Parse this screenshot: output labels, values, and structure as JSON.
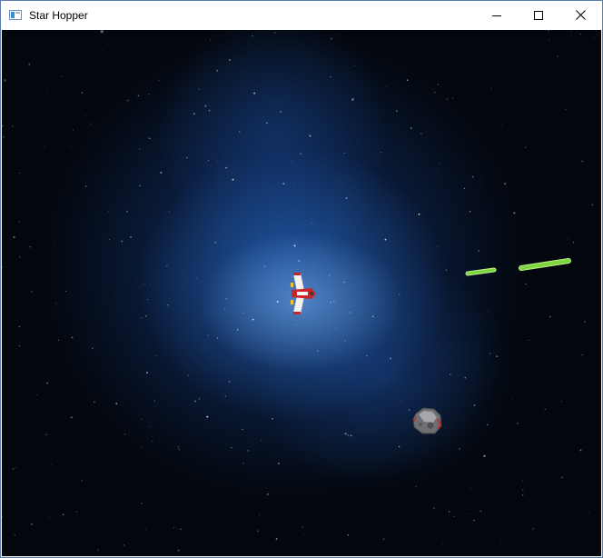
{
  "window": {
    "title": "Star Hopper",
    "icon": "app-window-icon",
    "controls": [
      "minimize-icon",
      "maximize-icon",
      "close-icon"
    ]
  },
  "scene": {
    "player_ship": {
      "icon": "red-white-spaceship-sprite"
    },
    "lasers": [
      {
        "icon": "green-laser-bolt",
        "color": "#8fd94a"
      },
      {
        "icon": "green-laser-bolt",
        "color": "#8fd94a"
      }
    ],
    "asteroid": {
      "icon": "grey-asteroid-sprite"
    },
    "background": {
      "colors": {
        "space": "#03060c",
        "nebula": "#2a5fb0",
        "nebula_core": "#8fbbe8"
      }
    }
  }
}
